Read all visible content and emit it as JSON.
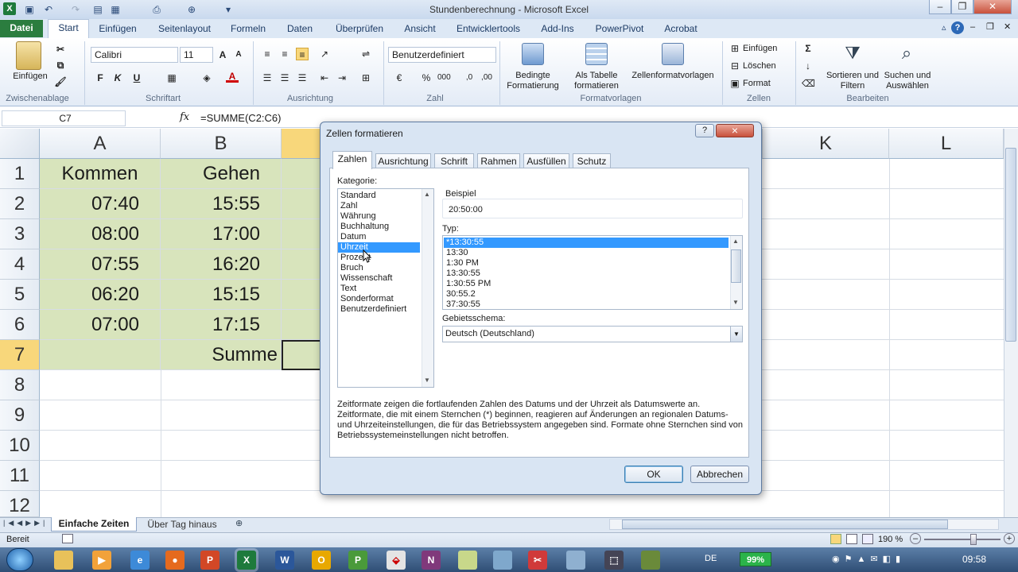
{
  "app": {
    "title": "Stundenberechnung - Microsoft Excel"
  },
  "tabs": [
    "Datei",
    "Start",
    "Einfügen",
    "Seitenlayout",
    "Formeln",
    "Daten",
    "Überprüfen",
    "Ansicht",
    "Entwicklertools",
    "Add-Ins",
    "PowerPivot",
    "Acrobat"
  ],
  "ribbon": {
    "paste_label": "Einfügen",
    "font_name": "Calibri",
    "font_size": "11",
    "number_format": "Benutzerdefiniert",
    "cond_format": "Bedingte Formatierung",
    "as_table": "Als Tabelle formatieren",
    "cell_styles": "Zellenformatvorlagen",
    "insert": "Einfügen",
    "delete": "Löschen",
    "format": "Format",
    "sort_filter": "Sortieren und Filtern",
    "find_select": "Suchen und Auswählen",
    "groups": {
      "clipboard": "Zwischenablage",
      "font": "Schriftart",
      "alignment": "Ausrichtung",
      "number": "Zahl",
      "styles": "Formatvorlagen",
      "cells": "Zellen",
      "editing": "Bearbeiten"
    }
  },
  "formula_bar": {
    "name_box": "C7",
    "fx": "fx",
    "formula": "=SUMME(C2:C6)"
  },
  "columns": [
    "A",
    "B",
    "K",
    "L"
  ],
  "rows": [
    "1",
    "2",
    "3",
    "4",
    "5",
    "6",
    "7",
    "8",
    "9",
    "10",
    "11",
    "12"
  ],
  "cells": {
    "a1": "Kommen",
    "b1": "Gehen",
    "a2": "07:40",
    "b2": "15:55",
    "a3": "08:00",
    "b3": "17:00",
    "a4": "07:55",
    "b4": "16:20",
    "a5": "06:20",
    "b5": "15:15",
    "a6": "07:00",
    "b6": "17:15",
    "b7": "Summe"
  },
  "dialog": {
    "title": "Zellen formatieren",
    "help": "?",
    "close": "×",
    "tabs": [
      "Zahlen",
      "Ausrichtung",
      "Schrift",
      "Rahmen",
      "Ausfüllen",
      "Schutz"
    ],
    "category_label": "Kategorie:",
    "categories": [
      "Standard",
      "Zahl",
      "Währung",
      "Buchhaltung",
      "Datum",
      "Uhrzeit",
      "Prozent",
      "Bruch",
      "Wissenschaft",
      "Text",
      "Sonderformat",
      "Benutzerdefiniert"
    ],
    "selected_category": "Uhrzeit",
    "sample_label": "Beispiel",
    "sample_value": "20:50:00",
    "type_label": "Typ:",
    "types": [
      "*13:30:55",
      "13:30",
      "1:30 PM",
      "13:30:55",
      "1:30:55 PM",
      "30:55.2",
      "37:30:55"
    ],
    "locale_label": "Gebietsschema:",
    "locale_value": "Deutsch (Deutschland)",
    "description": "Zeitformate zeigen die fortlaufenden Zahlen des Datums und der Uhrzeit als Datumswerte an. Zeitformate, die mit einem Sternchen (*) beginnen, reagieren auf Änderungen an regionalen Datums- und Uhrzeiteinstellungen, die für das Betriebssystem angegeben sind. Formate ohne Sternchen sind von Betriebssystemeinstellungen nicht betroffen.",
    "ok": "OK",
    "cancel": "Abbrechen"
  },
  "sheets": {
    "active": "Einfache Zeiten",
    "other": "Über Tag hinaus"
  },
  "status": {
    "ready": "Bereit",
    "zoom": "190 %"
  },
  "taskbar": {
    "lang": "DE",
    "battery": "99%",
    "time": "09:58"
  }
}
